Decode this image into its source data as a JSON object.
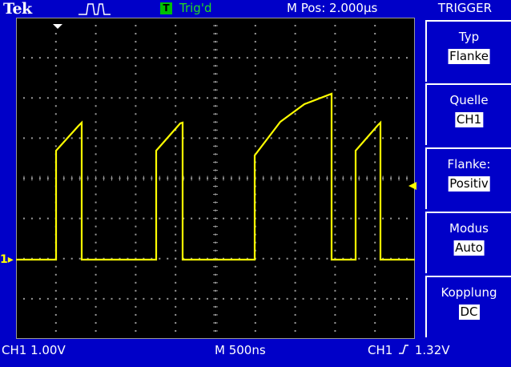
{
  "header": {
    "brand": "Tek",
    "acquisition_icon": "pulse-acquisition-icon",
    "trigger_badge": "T",
    "trigger_status": "Trig'd",
    "horizontal_position": "M Pos: 2.000µs"
  },
  "side_menu": {
    "title": "TRIGGER",
    "items": [
      {
        "label": "Typ",
        "value": "Flanke"
      },
      {
        "label": "Quelle",
        "value": "CH1"
      },
      {
        "label": "Flanke:",
        "value": "Positiv"
      },
      {
        "label": "Modus",
        "value": "Auto"
      },
      {
        "label": "Kopplung",
        "value": "DC"
      }
    ]
  },
  "footer": {
    "ch1_scale": "CH1  1.00V",
    "time_scale": "M 500ns",
    "trigger_source": "CH1",
    "trigger_level": "1.32V"
  },
  "markers": {
    "channel_ground": "1"
  },
  "colors": {
    "frame": "#0000c8",
    "screen": "#000000",
    "trace": "#ffff00",
    "grid": "#9a9a9a",
    "trigger_ok": "#22dd22"
  }
}
